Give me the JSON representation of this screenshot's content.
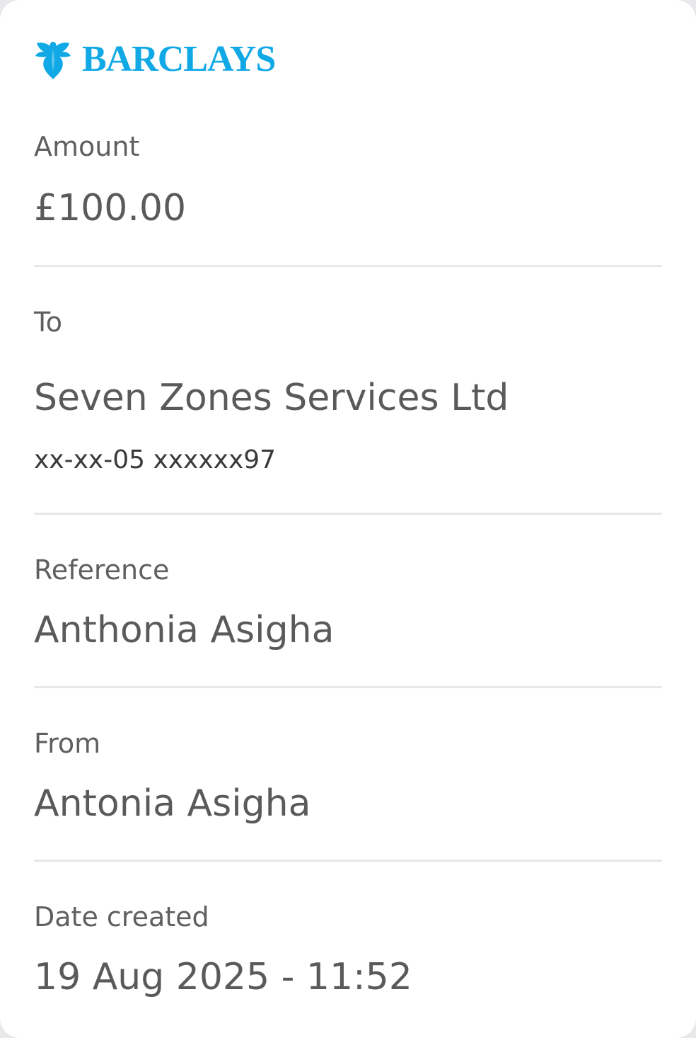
{
  "brand": {
    "name": "BARCLAYS",
    "logo_icon": "eagle-icon",
    "color": "#10a9e6"
  },
  "colors": {
    "label": "#5f5f5f",
    "value": "#5a5a5a",
    "sub": "#3a3a3a",
    "divider": "#e8e8e8"
  },
  "amount": {
    "label": "Amount",
    "value": "£100.00"
  },
  "recipient": {
    "label": "To",
    "name": "Seven Zones Services Ltd",
    "account": "xx-xx-05 xxxxxx97"
  },
  "reference": {
    "label": "Reference",
    "value": "Anthonia Asigha"
  },
  "sender": {
    "label": "From",
    "value": "Antonia Asigha"
  },
  "date_created": {
    "label": "Date created",
    "value": "19 Aug 2025 - 11:52"
  }
}
